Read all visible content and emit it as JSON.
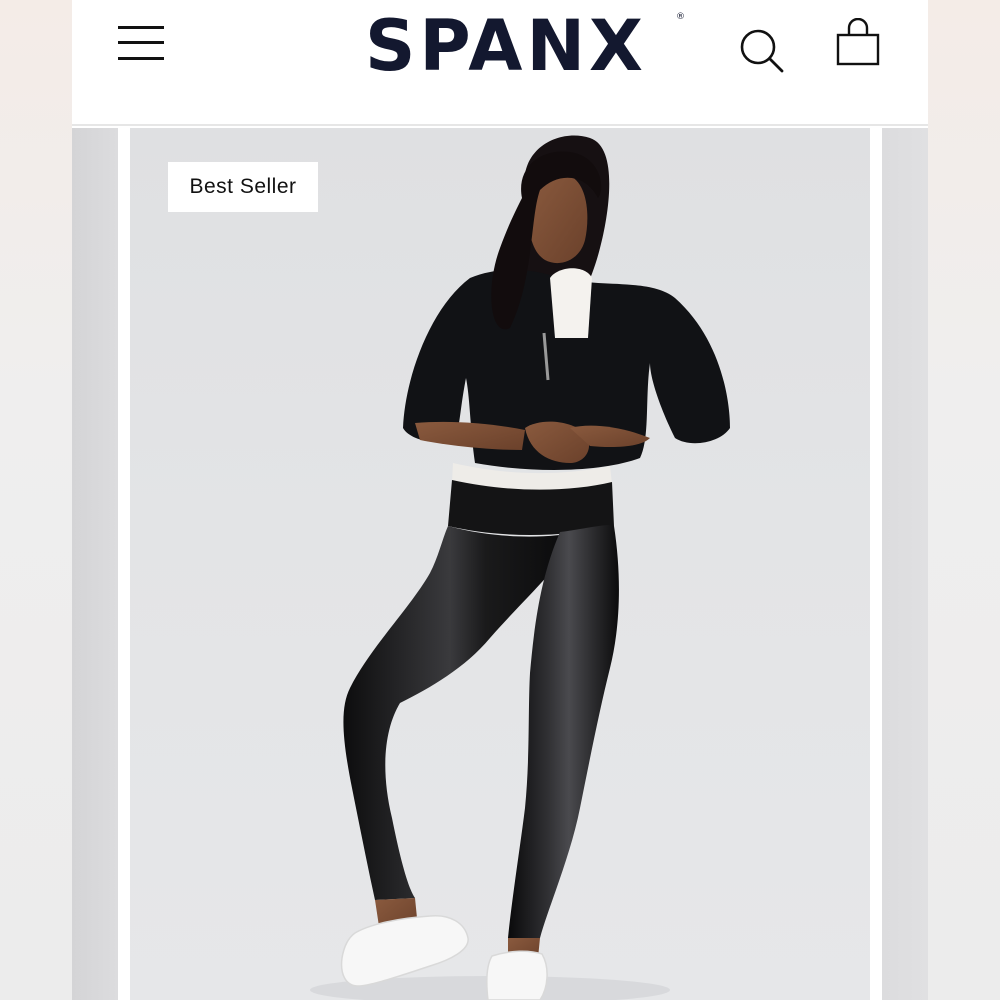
{
  "header": {
    "brand": "SPANX",
    "brand_mark": "®",
    "menu_icon": "hamburger-menu-icon",
    "search_icon": "search-icon",
    "bag_icon": "shopping-bag-icon"
  },
  "product": {
    "badge": "Best Seller",
    "image": "model-in-black-faux-leather-leggings"
  },
  "colors": {
    "brand_navy": "#13182f",
    "background": "#ffffff",
    "slide_background": "#e2e3e5"
  }
}
